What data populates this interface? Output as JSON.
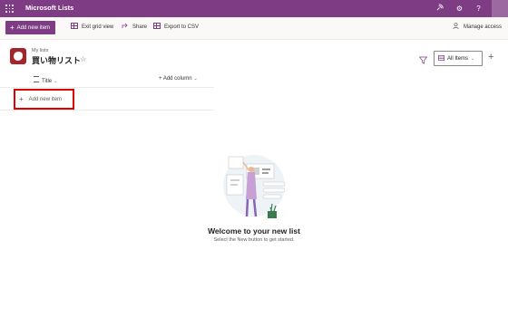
{
  "suitebar": {
    "app_title": "Microsoft Lists",
    "icons": [
      "waffle-icon",
      "feed-icon",
      "gear-icon",
      "help-icon"
    ]
  },
  "commandbar": {
    "add_new_item": "Add new item",
    "exit_grid_view": "Exit grid view",
    "share": "Share",
    "export_csv": "Export to CSV",
    "manage_access": "Manage access"
  },
  "list": {
    "breadcrumb": "My lists",
    "title": "買い物リスト",
    "accent": "#a4262c"
  },
  "view": {
    "selected": "All Items"
  },
  "grid": {
    "columns": [
      {
        "label": "Title"
      }
    ],
    "add_column": "Add column",
    "add_row": "Add new item"
  },
  "empty_state": {
    "title": "Welcome to your new list",
    "subtitle": "Select the New button to get started."
  },
  "colors": {
    "brand": "#7d3c84",
    "highlight_box": "#e00000"
  }
}
